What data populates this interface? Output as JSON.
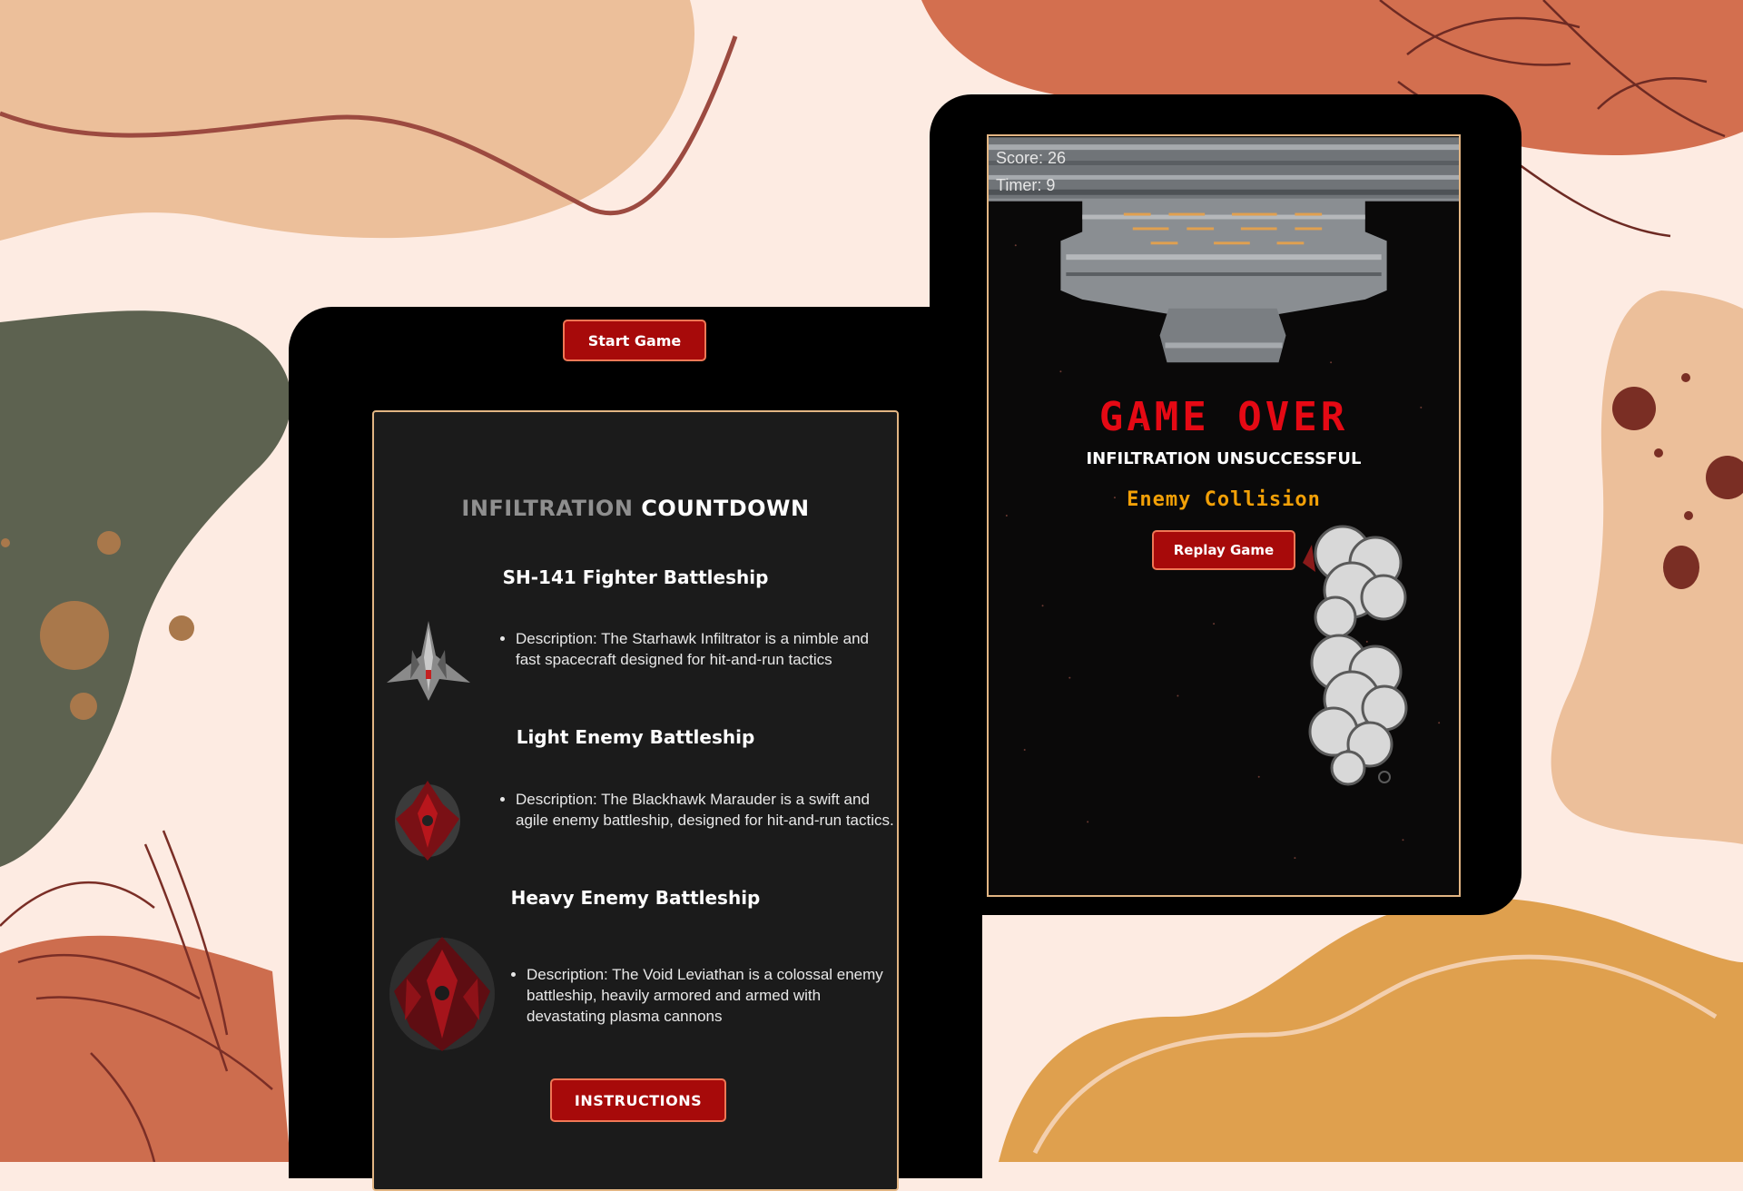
{
  "colors": {
    "page_background": "#fdebe2",
    "button_red": "#a70a0a",
    "panel_border": "#e2b583",
    "game_over_red": "#e50914",
    "reason_orange": "#f2a007"
  },
  "left_tablet": {
    "start_button": "Start Game",
    "panel": {
      "title_dim": "INFILTRATION ",
      "title_bright": "COUNTDOWN",
      "ships": [
        {
          "name": "SH-141 Fighter Battleship",
          "description": "Description: The Starhawk Infiltrator is a nimble and fast spacecraft designed for hit-and-run tactics",
          "icon": "fighter-ship-icon"
        },
        {
          "name": "Light Enemy Battleship",
          "description": "Description: The Blackhawk Marauder is a swift and agile enemy battleship, designed for hit-and-run tactics.",
          "icon": "light-enemy-ship-icon"
        },
        {
          "name": "Heavy Enemy Battleship",
          "description": "Description: The Void Leviathan is a colossal enemy battleship, heavily armored and armed with devastating plasma cannons",
          "icon": "heavy-enemy-ship-icon"
        }
      ],
      "instructions_button": "INSTRUCTIONS"
    }
  },
  "right_tablet": {
    "score": "Score: 26",
    "timer": "Timer: 9",
    "game_over": "GAME OVER",
    "subtitle": "INFILTRATION UNSUCCESSFUL",
    "reason": "Enemy Collision",
    "replay_button": "Replay Game",
    "icons": [
      "space-station-icon",
      "smoke-explosion-icon"
    ]
  }
}
